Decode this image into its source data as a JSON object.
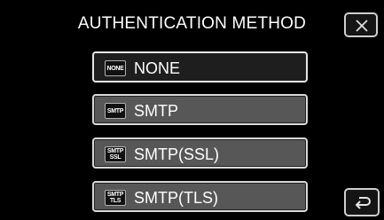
{
  "header": {
    "title": "AUTHENTICATION METHOD"
  },
  "options": [
    {
      "badge_lines": [
        "NONE"
      ],
      "label": "NONE",
      "selected": true
    },
    {
      "badge_lines": [
        "SMTP"
      ],
      "label": "SMTP",
      "selected": false
    },
    {
      "badge_lines": [
        "SMTP",
        "SSL"
      ],
      "label": "SMTP(SSL)",
      "selected": false
    },
    {
      "badge_lines": [
        "SMTP",
        "TLS"
      ],
      "label": "SMTP(TLS)",
      "selected": false
    }
  ],
  "icons": {
    "close": "close-icon",
    "back": "return-arrow-icon"
  },
  "colors": {
    "background": "#000000",
    "button_face": "#575757",
    "selected_face": "#1e1e1e",
    "border": "#d9d9d9",
    "text": "#ffffff"
  }
}
